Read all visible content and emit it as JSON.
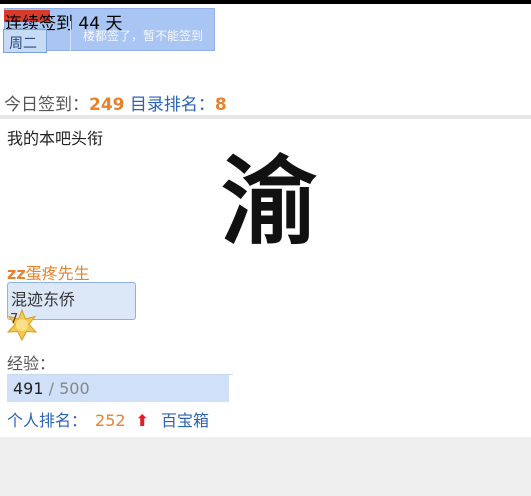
{
  "checkin": {
    "streak": "连续签到 44 天",
    "weekday": "周二",
    "disabled_label": "楼都签了，暂不能签到",
    "accent_color": "#a9c5f3"
  },
  "stats": {
    "today_label": "今日签到：",
    "today_value": "249",
    "rank_label": "目录排名：",
    "rank_value": "8"
  },
  "title_section": {
    "heading": "我的本吧头衔",
    "calligraphy_char": "渝",
    "username_prefix": "zz",
    "username_rest": "蛋疼先生",
    "badge": "混迹东侨",
    "level": "7",
    "exp_label": "经验：",
    "exp_current": "491",
    "exp_max": " / 500",
    "exp_fraction": 0.982,
    "rank_label": "个人排名：",
    "rank_value": "252",
    "rank_arrow": "⬆",
    "treasure_label": "百宝箱"
  }
}
